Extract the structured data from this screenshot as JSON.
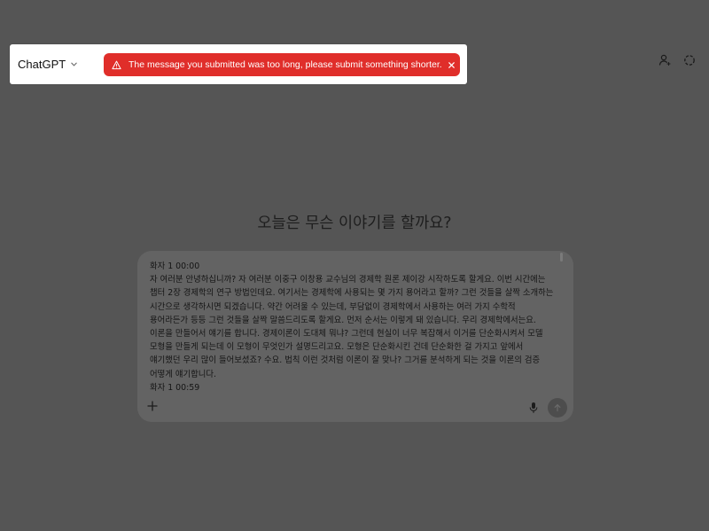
{
  "header": {
    "model_label": "ChatGPT",
    "alert_message": "The message you submitted was too long, please submit something shorter."
  },
  "main": {
    "heading": "오늘은 무슨 이야기를 할까요?"
  },
  "composer": {
    "text": "화자 1 00:00\n자 여러분 안녕하십니까? 자 여러분 이중구 이창용 교수님의 경제학 원론 제이강 시작하도록 할게요. 이번 시간에는 챕터 2장 경제학의 연구 방법인데요. 여기서는 경제학에 사용되는 몇 가지 용어라고 할까? 그런 것들을 살짝 소개하는 시간으로 생각하시면 되겠습니다. 약간 어려울 수 있는데, 부담없이 경제학에서 사용하는 여러 가지 수학적 용어라든가 등등 그런 것들을 살짝 말씀드리도록 할게요. 먼저 순서는 이렇게 돼 있습니다. 우리 경제학에서는요. 이론을 만들어서 얘기를 합니다. 경제이론이 도대체 뭐냐? 그런데 현실이 너무 복잡해서 이거를 단순화시켜서 모델 모형을 만들게 되는데 이 모형이 무엇인가 설명드리고요. 모형은 단순화시킨 건데 단순화한 걸 가지고 앞에서 얘기했던 우리 많이 들어보셨죠? 수요. 법칙 이런 것처럼 이론이 잘 맞나? 그거를 분석하게 되는 것을 이론의 검증 어떻게 얘기합니다.\n화자 1 00:59"
  },
  "colors": {
    "alert_bg": "#e02e2a",
    "backdrop": "#555555",
    "composer_bg": "#636363"
  },
  "icons": {
    "model_dropdown": "chevron-down-icon",
    "alert": "warning-triangle-icon",
    "alert_close": "close-icon",
    "profile": "person-icon",
    "temporary_chat": "dashed-circle-icon",
    "attach": "plus-icon",
    "voice": "microphone-icon",
    "send": "arrow-up-icon"
  }
}
